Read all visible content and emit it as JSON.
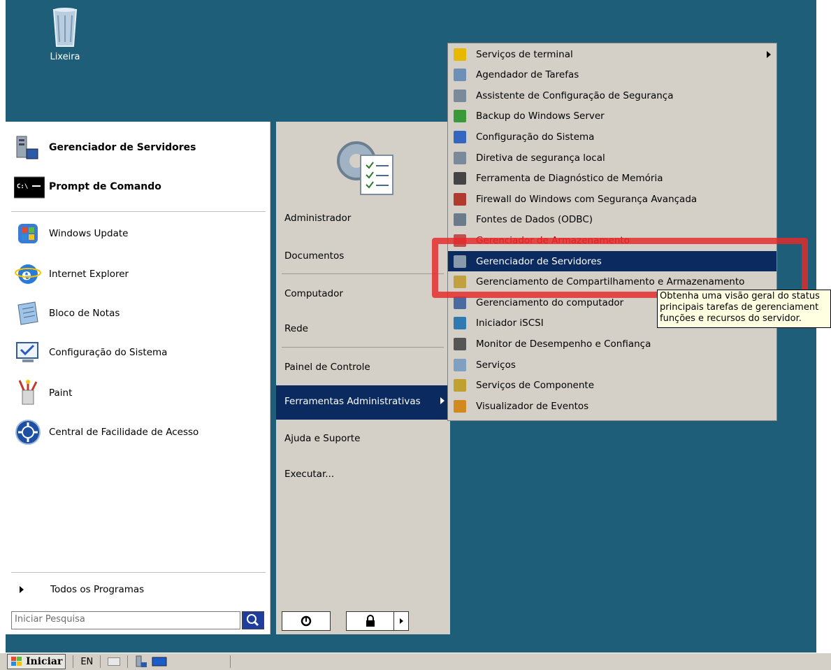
{
  "desktop": {
    "recycle_bin_label": "Lixeira"
  },
  "start_menu": {
    "pinned": [
      {
        "label": "Gerenciador de Servidores",
        "icon": "server-manager-icon"
      },
      {
        "label": "Prompt de Comando",
        "icon": "command-prompt-icon"
      }
    ],
    "recent": [
      {
        "label": "Windows Update",
        "icon": "windows-update-icon"
      },
      {
        "label": "Internet Explorer",
        "icon": "internet-explorer-icon"
      },
      {
        "label": "Bloco de Notas",
        "icon": "notepad-icon"
      },
      {
        "label": "Configuração do Sistema",
        "icon": "system-config-icon"
      },
      {
        "label": "Paint",
        "icon": "paint-icon"
      },
      {
        "label": "Central de Facilidade de Acesso",
        "icon": "ease-of-access-icon"
      }
    ],
    "all_programs": "Todos os Programas",
    "search_placeholder": "Iniciar Pesquisa",
    "right": {
      "user": "Administrador",
      "documents": "Documentos",
      "computer": "Computador",
      "network": "Rede",
      "control_panel": "Painel de Controle",
      "admin_tools": "Ferramentas Administrativas",
      "help": "Ajuda e Suporte",
      "run": "Executar..."
    }
  },
  "submenu": {
    "items": [
      {
        "label": "Serviços de terminal",
        "icon": "folder-icon",
        "color": "#e6b800"
      },
      {
        "label": "Agendador de Tarefas",
        "icon": "clock-icon",
        "color": "#6e8fb8"
      },
      {
        "label": "Assistente de Configuração de Segurança",
        "icon": "security-wizard-icon",
        "color": "#7a8a9a"
      },
      {
        "label": "Backup do Windows Server",
        "icon": "backup-icon",
        "color": "#3a9a3a"
      },
      {
        "label": "Configuração do Sistema",
        "icon": "system-config-icon",
        "color": "#3566c0"
      },
      {
        "label": "Diretiva de segurança local",
        "icon": "local-policy-icon",
        "color": "#7a8a9a"
      },
      {
        "label": "Ferramenta de Diagnóstico de Memória",
        "icon": "memory-icon",
        "color": "#444444"
      },
      {
        "label": "Firewall do Windows com Segurança Avançada",
        "icon": "firewall-icon",
        "color": "#b03a2e"
      },
      {
        "label": "Fontes de Dados (ODBC)",
        "icon": "odbc-icon",
        "color": "#6b7b8b"
      },
      {
        "label": "Gerenciador de Armazenamento",
        "icon": "storage-icon",
        "color": "#c05050"
      },
      {
        "label": "Gerenciador de Servidores",
        "icon": "server-manager-icon",
        "color": "#8899aa"
      },
      {
        "label": "Gerenciamento de Compartilhamento e Armazenamento",
        "icon": "share-storage-icon",
        "color": "#c0a040"
      },
      {
        "label": "Gerenciamento do computador",
        "icon": "computer-management-icon",
        "color": "#4a6aa0"
      },
      {
        "label": "Iniciador iSCSI",
        "icon": "iscsi-icon",
        "color": "#2f7ab0"
      },
      {
        "label": "Monitor de Desempenho e Confiança",
        "icon": "performance-icon",
        "color": "#555555"
      },
      {
        "label": "Serviços",
        "icon": "services-icon",
        "color": "#7fa0c0"
      },
      {
        "label": "Serviços de Componente",
        "icon": "component-services-icon",
        "color": "#c0a030"
      },
      {
        "label": "Visualizador de Eventos",
        "icon": "event-viewer-icon",
        "color": "#d08a20"
      }
    ],
    "highlighted_index": 10
  },
  "tooltip": {
    "line1": "Obtenha uma visão geral do status",
    "line2": "principais tarefas de gerenciament",
    "line3": "funções e recursos do servidor."
  },
  "taskbar": {
    "start_label": "Iniciar",
    "language": "EN"
  },
  "colors": {
    "desktop": "#1f5e78",
    "highlight": "#0b2a60",
    "annotation": "#e62828"
  }
}
